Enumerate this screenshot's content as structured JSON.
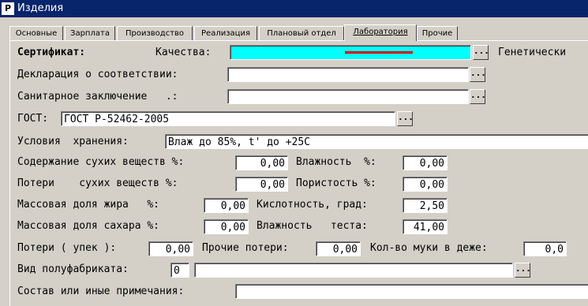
{
  "window": {
    "title": "Изделия",
    "icon": "app-icon"
  },
  "tabs": [
    {
      "label": "Основные"
    },
    {
      "label": "Зарплата"
    },
    {
      "label": "Производство"
    },
    {
      "label": "Реализация"
    },
    {
      "label": "Плановый отдел"
    },
    {
      "label": "Лаборатория"
    },
    {
      "label": "Прочие"
    }
  ],
  "active_tab": "Лаборатория",
  "form": {
    "certificate_label": "Сертификат:",
    "quality_label": "Качества:",
    "quality_value": "",
    "genetic_label": "Генетически",
    "declaration_label": "Декларация о соответствии:",
    "declaration_value": "",
    "sanitary_label": "Санитарное заключение   .:",
    "sanitary_value": "",
    "gost_label": "ГОСТ:",
    "gost_value": "ГОСТ Р-52462-2005",
    "storage_label": "Условия  хранения:",
    "storage_value": "Влаж до 85%, t' до +25С",
    "dry_matter_label": "Содержание сухих веществ %:",
    "dry_matter_value": "0,00",
    "humidity_label": "Влажность  %:",
    "humidity_value": "0,00",
    "dry_loss_label": "Потери    сухих веществ %:",
    "dry_loss_value": "0,00",
    "porosity_label": "Пористость %:",
    "porosity_value": "0,00",
    "fat_label": "Массовая доля жира   %:",
    "fat_value": "0,00",
    "acidity_label": "Кислотность, град:",
    "acidity_value": "2,50",
    "sugar_label": "Массовая доля сахара %:",
    "sugar_value": "0,00",
    "dough_humidity_label": "Влажность   теста:",
    "dough_humidity_value": "41,00",
    "bake_loss_label": "Потери ( упек ):",
    "bake_loss_value": "0,00",
    "other_loss_label": "Прочие потери:",
    "other_loss_value": "0,00",
    "flour_label": "Кол-во муки в деже:",
    "flour_value": "0,0",
    "semi_label": "Вид полуфабриката:",
    "semi_code": "0",
    "semi_value": "",
    "notes_label": "Состав или иные примечания:",
    "notes_value": "",
    "ellipsis": "..."
  },
  "colors": {
    "title_bg": "#08246b",
    "highlight": "#00ffff",
    "active_underline": "#e00000"
  }
}
